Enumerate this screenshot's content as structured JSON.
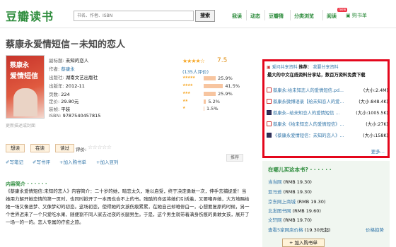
{
  "header": {
    "logo": "豆瓣读书",
    "search_placeholder": "书名、作者、ISBN",
    "search_button": "搜索",
    "nav": [
      "我读",
      "动态",
      "豆瓣猜",
      "分类浏览",
      "阅读"
    ],
    "new_badge": "new",
    "cart": "购书单"
  },
  "book": {
    "title": "蔡康永爱情短信－未知的恋人",
    "cover_title_1": "蔡康永",
    "cover_title_2": "爱情短信",
    "cover_more": "更新描述或封面",
    "info": [
      {
        "label": "副标题:",
        "value": "未知的恋人",
        "link": false
      },
      {
        "label": "作者:",
        "value": "蔡康永",
        "link": true
      },
      {
        "label": "出版社:",
        "value": "湖南文艺出版社",
        "link": false
      },
      {
        "label": "出版年:",
        "value": "2012-11",
        "link": false
      },
      {
        "label": "页数:",
        "value": "224",
        "link": false
      },
      {
        "label": "定价:",
        "value": "29.80元",
        "link": false
      },
      {
        "label": "装帧:",
        "value": "平装",
        "link": false
      },
      {
        "label": "ISBN:",
        "value": "9787540457815",
        "link": false
      }
    ]
  },
  "rating": {
    "stars": "★★★★☆",
    "score": "7.5",
    "count": "(135人评价)",
    "rows": [
      {
        "stars": "★★★★★",
        "percent": 25.9,
        "label": "25.9%"
      },
      {
        "stars": "★★★★",
        "percent": 41.5,
        "label": "41.5%"
      },
      {
        "stars": "★★★",
        "percent": 25.9,
        "label": "25.9%"
      },
      {
        "stars": "★★",
        "percent": 5.2,
        "label": "5.2%"
      },
      {
        "stars": "★",
        "percent": 1.5,
        "label": "1.5%"
      }
    ]
  },
  "actions": {
    "want": "想读",
    "reading": "在读",
    "read": "读过",
    "eval_label": "评价:",
    "eval_stars": "☆☆☆☆☆",
    "write_note": "写笔记",
    "write_review": "写书评",
    "add_cart": "加入购书单",
    "add_doulist": "加入豆列",
    "recommend": "推荐"
  },
  "intro": {
    "heading": "内容简介 · · · · · ·",
    "text": "《蔡康永爱情短信:未知的恋人》内容简介：二十岁的她，暗恋太久，难以启受，终于决定勇敢一次，伸手去捕捉爱！当她用力解开她恋情的第一页时，也同时掀开了一本再也合不上的书。残酷的命运将她们引诱着，又要嘲弄她，大方地赐给她一场又像恶梦、又像梦幻的初恋。这场初恋，使得她的女孩伤痕累累，在她自己却难修白一，心想要复原的时候，另一个世界迟来了一个只爱吃水果、随便割不同人家去过夜的长腿男生。于是，这个男生就带着满身伤痕的勇敢女孩，展开了一场一的一的。恋人专属的疗愈之旅。"
  },
  "share": {
    "brand": "爱问共享资料",
    "recommend_label": "推荐：",
    "share_link": "我要分享资料",
    "subtitle": "最大的中文在线资料分享站，数百万资料免费下载",
    "files": [
      {
        "icon": "pdf",
        "name": "蔡康永:给未知恋人的爱情短信.pd...",
        "size": "(大小:2.4M)"
      },
      {
        "icon": "pdf",
        "name": "蔡康永微博语录【给未知恋人的爱...",
        "size": "(大小:848.4K)"
      },
      {
        "icon": "doc",
        "name": "蔡康永--给未知恋人的爱情短信 ...",
        "size": "(大小:1005.5K)"
      },
      {
        "icon": "pdf",
        "name": "蔡康永《给未知恋人的爱情短信》...",
        "size": "(大小:27K)"
      },
      {
        "icon": "doc",
        "name": "《蔡康永爱情短信：未知的恋人》...",
        "size": "(大小:158K)"
      }
    ],
    "more": "更多..."
  },
  "buy": {
    "heading": "在哪儿买这本书? · · · · · ·",
    "stores": [
      {
        "name": "当当网",
        "price": "(RMB 19.30)"
      },
      {
        "name": "亚马逊",
        "price": "(RMB 19.30)"
      },
      {
        "name": "京东网上商城",
        "price": "(RMB 19.30)"
      },
      {
        "name": "北发图书网",
        "price": "(RMB 19.60)"
      },
      {
        "name": "文轩网",
        "price": "(RMB 19.70)"
      },
      {
        "name": "查看5家网店价格",
        "price": "(19.30元起)"
      }
    ],
    "price_trend": "价格趋势",
    "cart_button": "加入购书单"
  }
}
